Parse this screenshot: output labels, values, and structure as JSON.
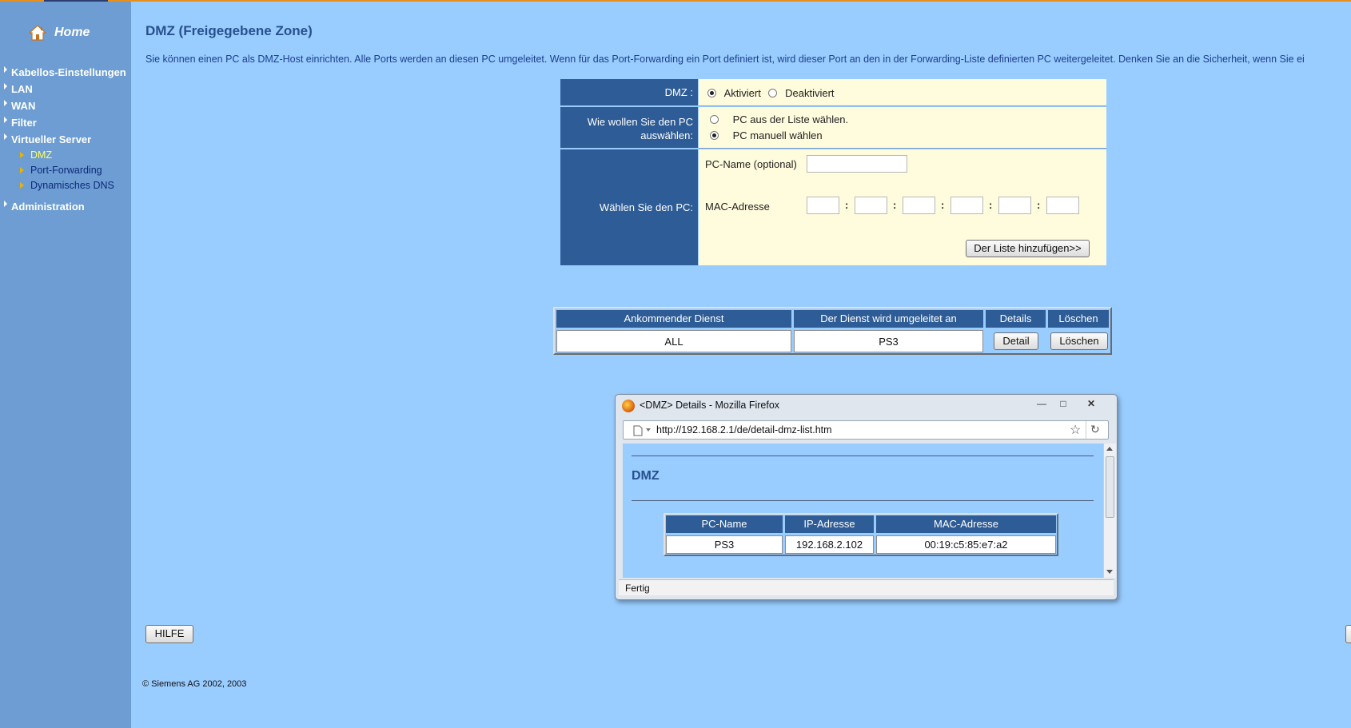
{
  "sidebar": {
    "home_label": "Home",
    "items": [
      {
        "label": "Kabellos-Einstellungen"
      },
      {
        "label": "LAN"
      },
      {
        "label": "WAN"
      },
      {
        "label": "Filter"
      },
      {
        "label": "Virtueller Server"
      }
    ],
    "sub_items": [
      {
        "label": "DMZ",
        "active": true
      },
      {
        "label": "Port-Forwarding"
      },
      {
        "label": "Dynamisches DNS"
      }
    ],
    "admin_label": "Administration"
  },
  "page": {
    "title": "DMZ (Freigegebene Zone)",
    "intro": "Sie können einen PC als DMZ-Host einrichten. Alle Ports werden an diesen PC umgeleitet. Wenn für das Port-Forwarding ein Port definiert ist, wird dieser Port an den in der Forwarding-Liste definierten PC weitergeleitet. Denken Sie an die Sicherheit, wenn Sie ei"
  },
  "dmz_form": {
    "dmz_label": "DMZ :",
    "option_on": "Aktiviert",
    "option_off": "Deaktiviert",
    "dmz_state": "Aktiviert",
    "select_label_line1": "Wie wollen Sie den PC",
    "select_label_line2": "auswählen:",
    "select_from_list": "PC aus der Liste wählen.",
    "select_manual": "PC manuell wählen",
    "select_state": "PC manuell wählen",
    "choose_label": "Wählen Sie den PC:",
    "pcname_label": "PC-Name (optional)",
    "pcname_value": "",
    "mac_label": "MAC-Adresse",
    "mac_values": [
      "",
      "",
      "",
      "",
      "",
      ""
    ],
    "add_button": "Der Liste hinzufügen>>"
  },
  "list_table": {
    "headers": [
      "Ankommender Dienst",
      "Der Dienst wird umgeleitet an",
      "Details",
      "Löschen"
    ],
    "rows": [
      {
        "service": "ALL",
        "target": "PS3",
        "detail_button": "Detail",
        "delete_button": "Löschen"
      }
    ]
  },
  "popup": {
    "title": "<DMZ> Details - Mozilla Firefox",
    "url": "http://192.168.2.1/de/detail-dmz-list.htm",
    "heading": "DMZ",
    "headers": [
      "PC-Name",
      "IP-Adresse",
      "MAC-Adresse"
    ],
    "row": [
      "PS3",
      "192.168.2.102",
      "00:19:c5:85:e7:a2"
    ],
    "status": "Fertig"
  },
  "footer": {
    "help_button": "HILFE",
    "copyright": "© Siemens AG 2002, 2003"
  },
  "colors": {
    "background": "#99ccff",
    "sidebar": "#6d9dd2",
    "label_cell": "#2e5c96",
    "value_cell": "#fffbdd",
    "active_link": "#ffff66"
  },
  "icons": [
    "home-icon",
    "firefox-icon",
    "page-icon",
    "star-icon",
    "reload-icon"
  ]
}
